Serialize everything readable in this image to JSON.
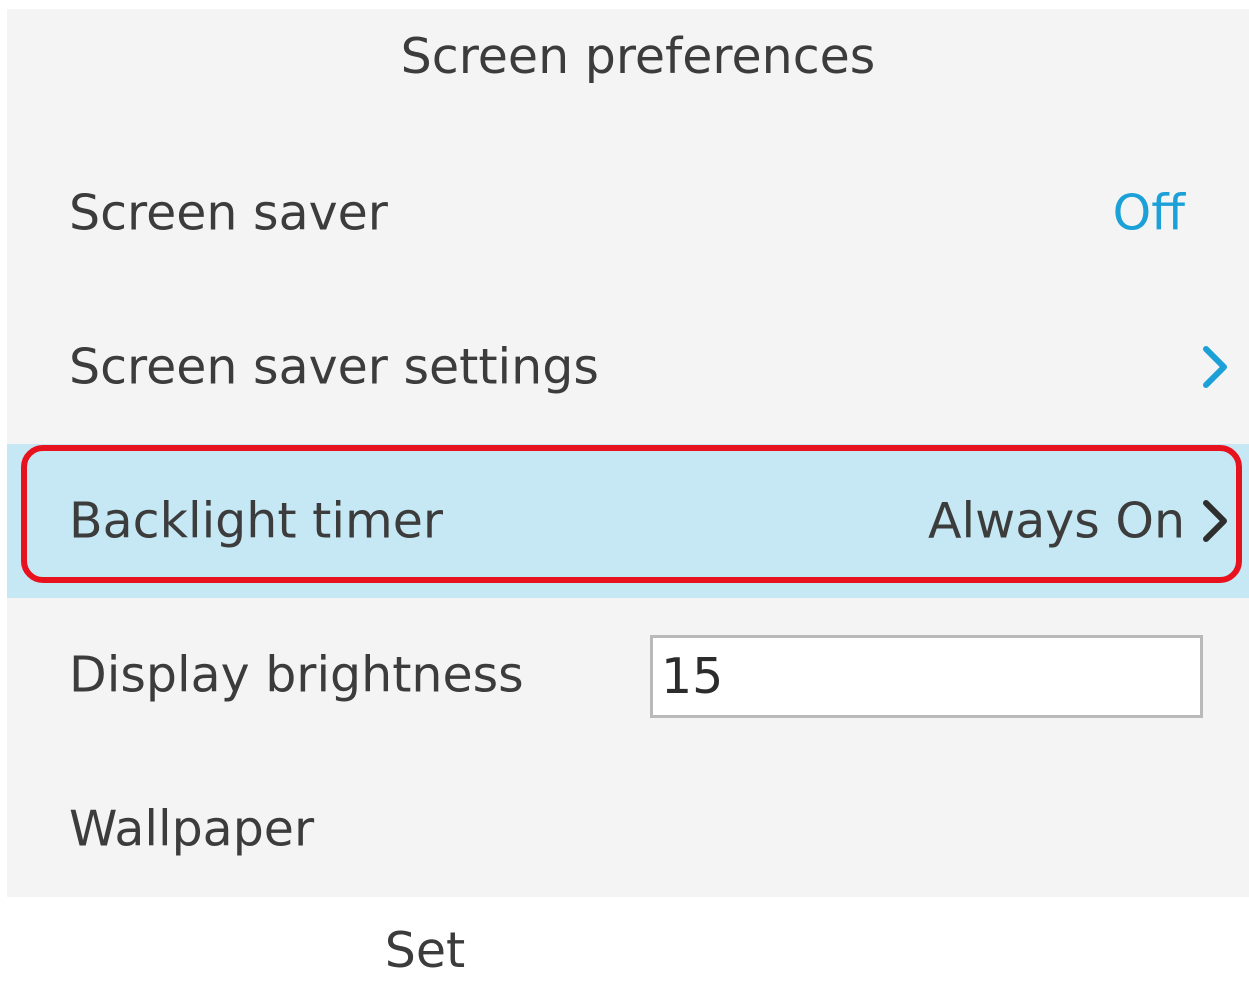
{
  "header": {
    "title": "Screen preferences"
  },
  "rows": [
    {
      "label": "Screen saver",
      "value": "Off",
      "icon": ""
    },
    {
      "label": "Screen saver settings",
      "value": "",
      "icon": "chevron-right-icon"
    },
    {
      "label": "Backlight timer",
      "value": "Always On",
      "icon": "chevron-right-icon",
      "selected": true
    },
    {
      "label": "Display brightness",
      "value": "15",
      "icon": ""
    },
    {
      "label": "Wallpaper",
      "value": "",
      "icon": ""
    }
  ],
  "softkeys": {
    "primary_label": "Set"
  },
  "colors": {
    "accent": "#1ba0d7",
    "selection": "#c5e8f4",
    "highlight_outline": "#e8121e",
    "background": "#f4f4f4"
  }
}
